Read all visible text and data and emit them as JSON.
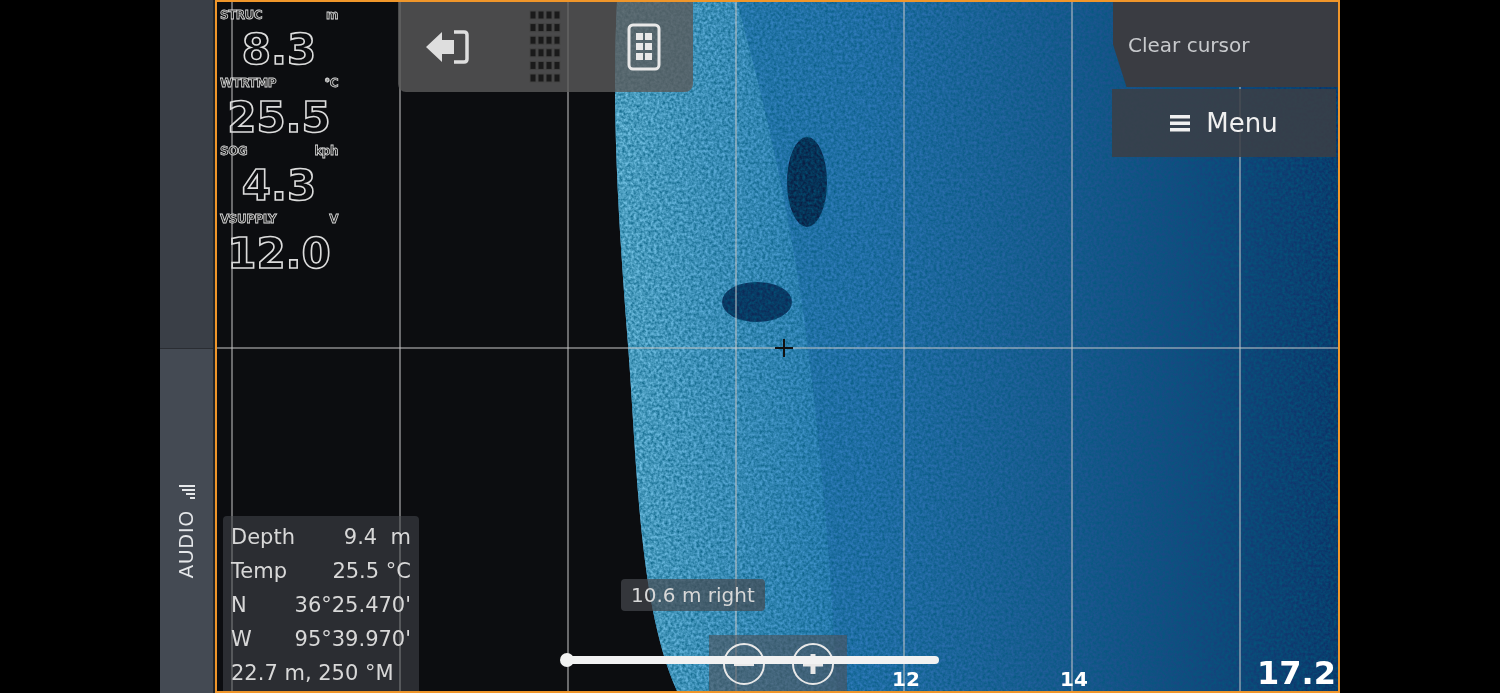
{
  "side_tab": {
    "label": "AUDIO"
  },
  "instruments": [
    {
      "label": "STRUC",
      "unit": "m",
      "value": "8.3"
    },
    {
      "label": "WTRTMP",
      "unit": "°C",
      "value": "25.5"
    },
    {
      "label": "SOG",
      "unit": "kph",
      "value": "4.3"
    },
    {
      "label": "VSUPPLY",
      "unit": "V",
      "value": "12.0"
    }
  ],
  "clear_cursor": {
    "label": "Clear cursor"
  },
  "menu": {
    "label": "Menu"
  },
  "cursor_info": [
    {
      "label": "Depth",
      "value": "9.4  m"
    },
    {
      "label": "Temp",
      "value": "25.5 °C"
    },
    {
      "label": "N",
      "value": "36°25.470'"
    },
    {
      "label": "W",
      "value": "95°39.970'"
    },
    {
      "value": "22.7 m, 250 °M"
    }
  ],
  "distance_label": "10.6 m right",
  "range_labels": [
    {
      "kind": "tick",
      "text": "12"
    },
    {
      "kind": "tick",
      "text": "14"
    },
    {
      "kind": "range",
      "text": "17.2"
    }
  ]
}
